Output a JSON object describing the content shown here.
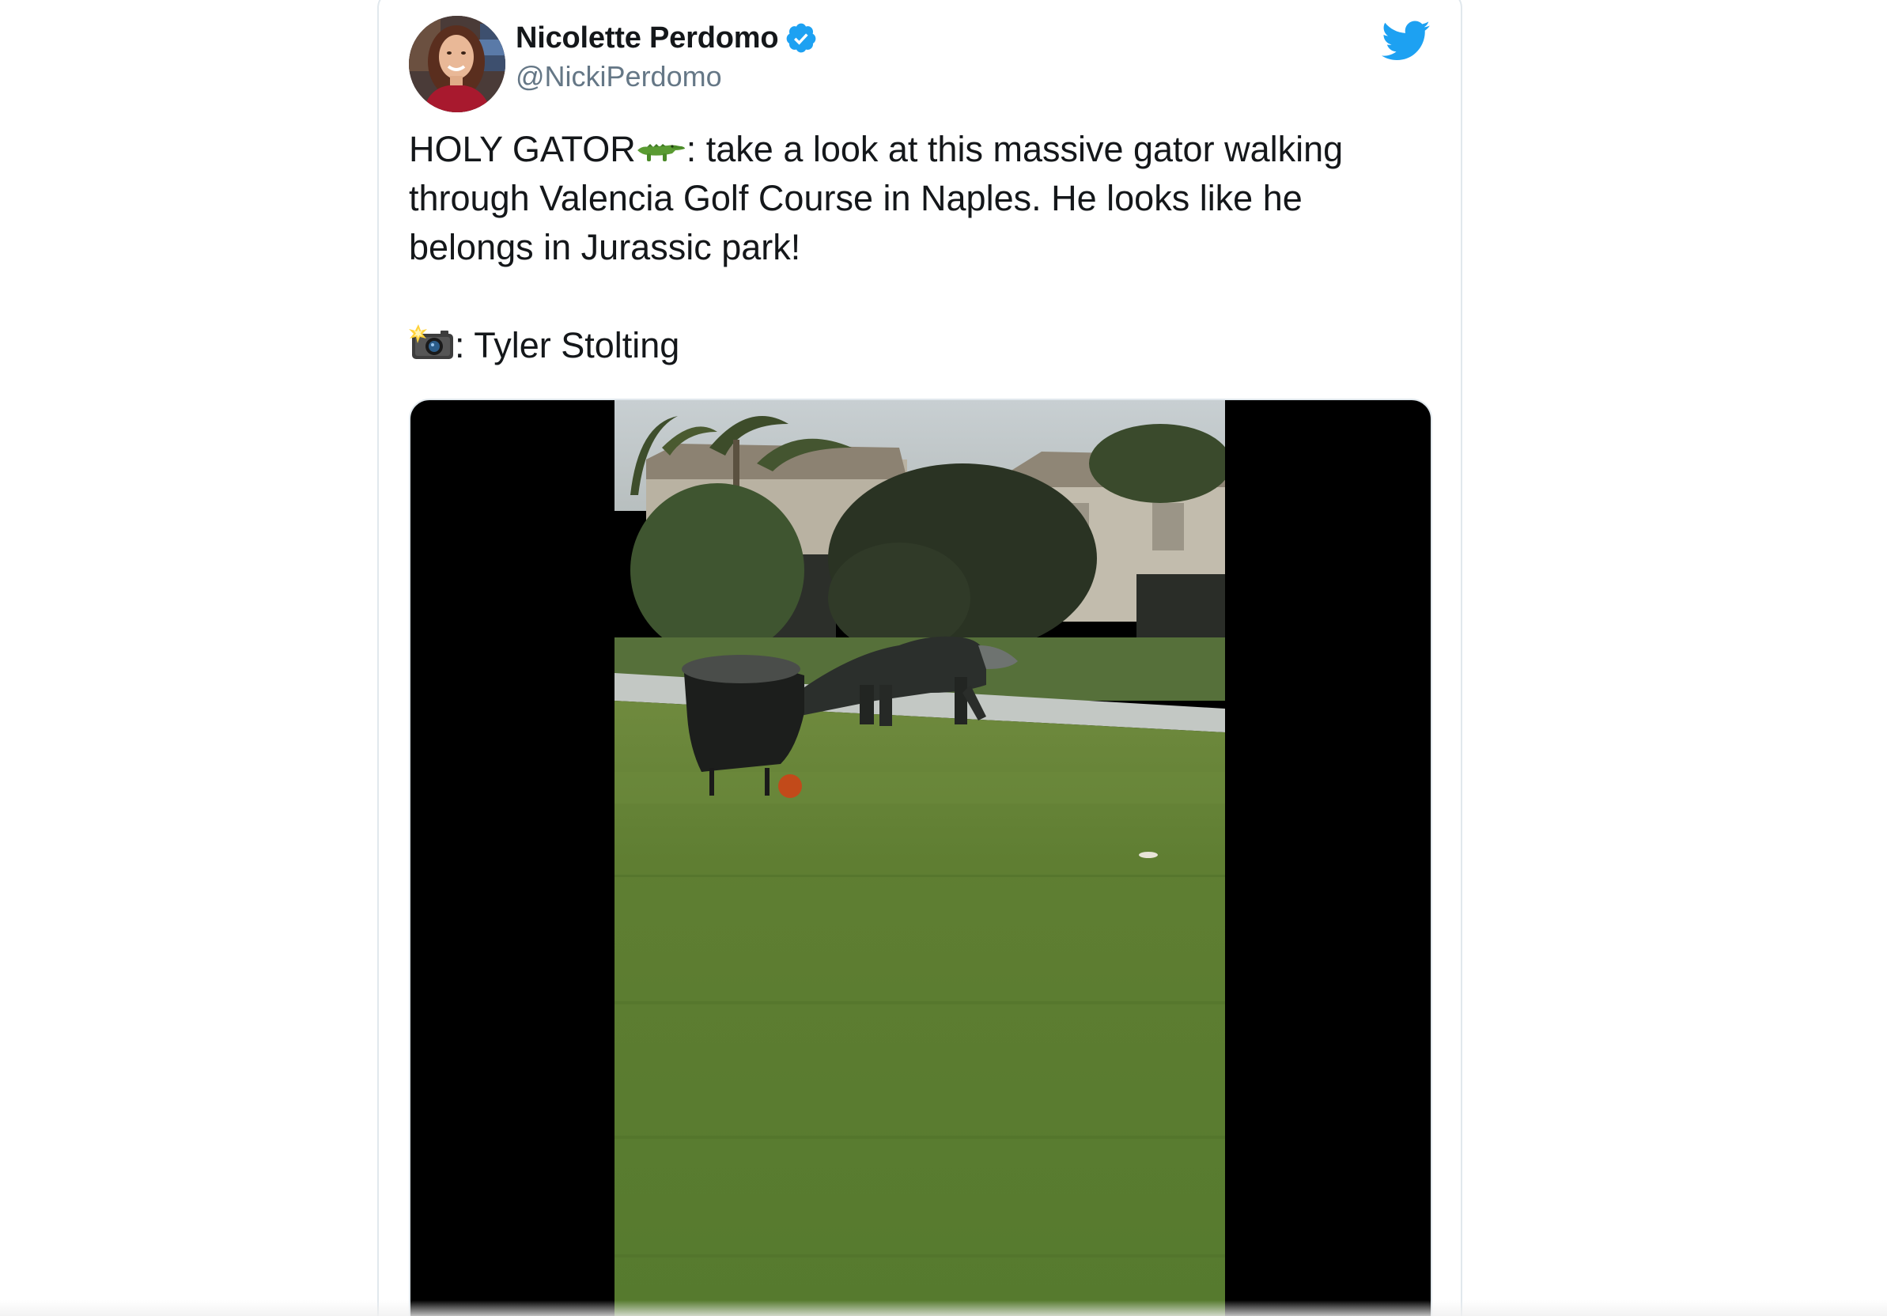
{
  "tweet": {
    "author": {
      "display_name": "Nicolette Perdomo",
      "handle": "@NickiPerdomo",
      "verified": true
    },
    "text": {
      "line1_before_emoji": "HOLY GATOR",
      "line1_emoji": "crocodile-emoji",
      "line1_after_emoji": ": take a look at this massive gator walking",
      "line2": "through Valencia Golf Course in Naples. He looks like he",
      "line3": "belongs in Jurassic park!",
      "credit_emoji": "camera-flash-emoji",
      "credit": ": Tyler Stolting"
    },
    "media": {
      "type": "video"
    }
  },
  "colors": {
    "twitter_blue": "#1da1f2",
    "text_primary": "#14171a",
    "text_secondary": "#657786",
    "border": "#e1e8ed",
    "verified_blue": "#1da1f2",
    "letterbox": "#000000"
  },
  "icons": {
    "brand": "twitter-bird-icon",
    "verified": "verified-badge-icon"
  }
}
